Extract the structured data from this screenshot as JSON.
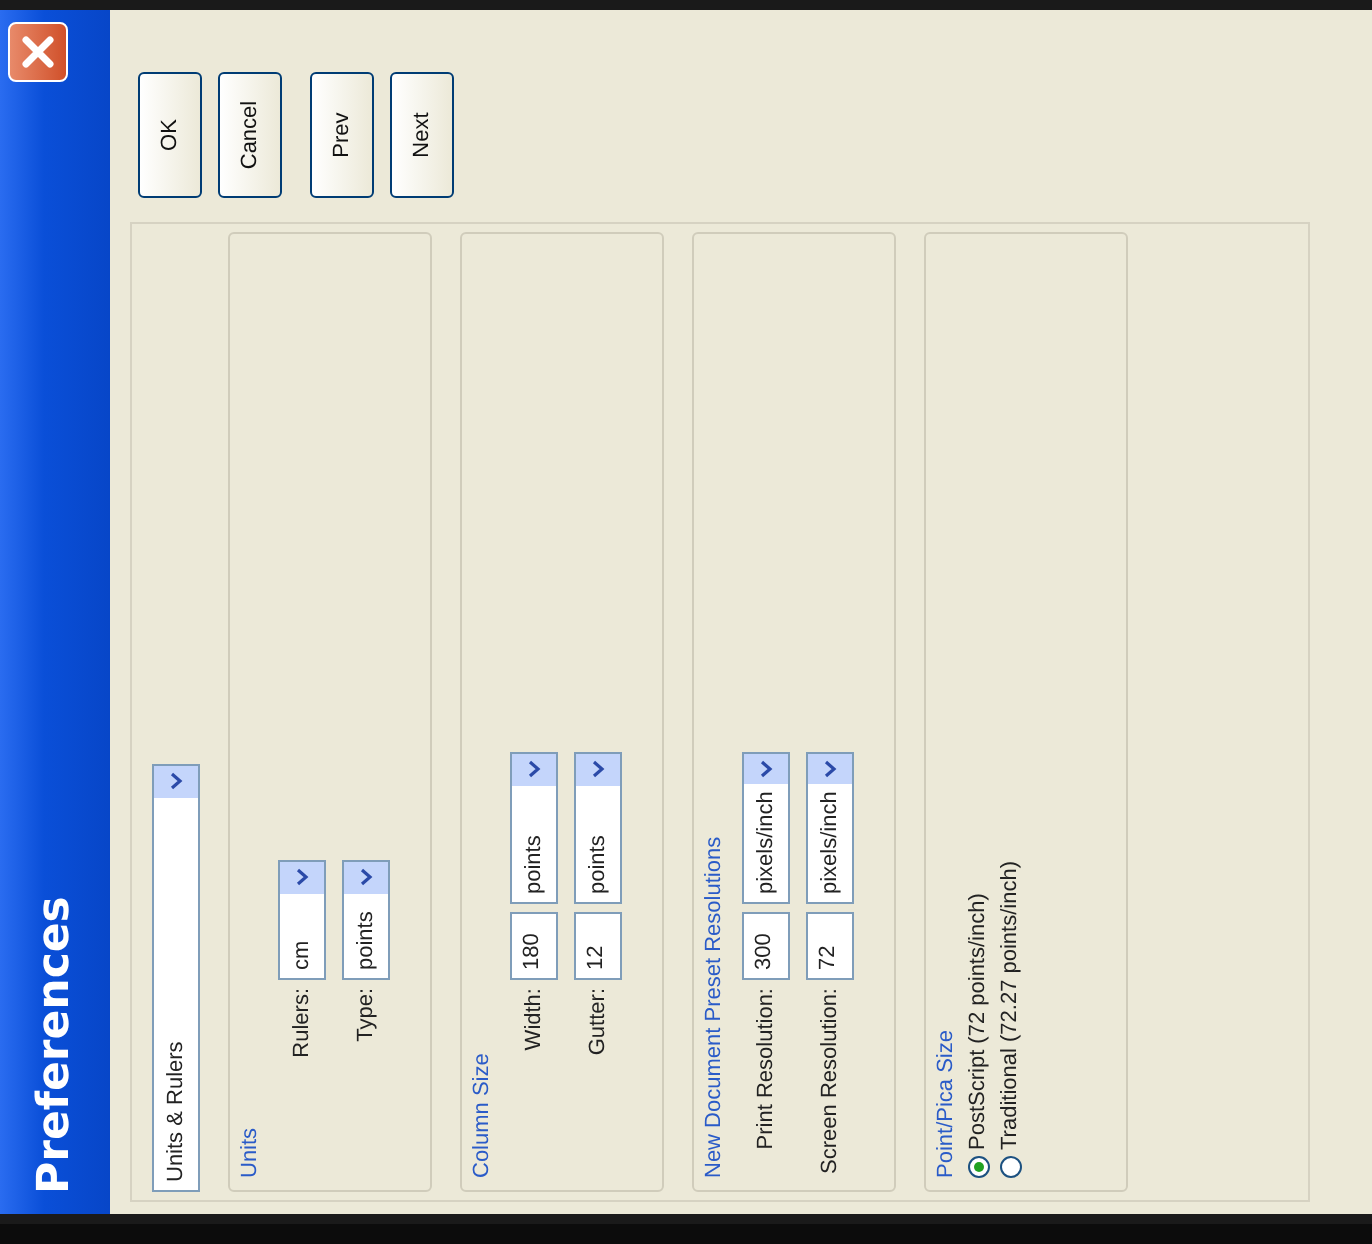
{
  "window": {
    "title": "Preferences"
  },
  "category": {
    "value": "Units & Rulers"
  },
  "groups": [
    {
      "title": "Units",
      "rows": [
        {
          "kind": "select",
          "label": "Rulers:",
          "value": "cm"
        },
        {
          "kind": "select",
          "label": "Type:",
          "value": "points"
        }
      ]
    },
    {
      "title": "Column Size",
      "rows": [
        {
          "kind": "number_unit",
          "label": "Width:",
          "value": "180",
          "unit": "points"
        },
        {
          "kind": "number_unit",
          "label": "Gutter:",
          "value": "12",
          "unit": "points"
        }
      ]
    },
    {
      "title": "New Document Preset Resolutions",
      "rows": [
        {
          "kind": "number_unit",
          "label": "Print Resolution:",
          "value": "300",
          "unit": "pixels/inch"
        },
        {
          "kind": "number_unit",
          "label": "Screen Resolution:",
          "value": "72",
          "unit": "pixels/inch"
        }
      ]
    },
    {
      "title": "Point/Pica Size",
      "rows": [
        {
          "kind": "radio",
          "label": "PostScript (72 points/inch)",
          "selected": true
        },
        {
          "kind": "radio",
          "label": "Traditional (72.27 points/inch)",
          "selected": false
        }
      ]
    }
  ],
  "actions": [
    "OK",
    "Cancel"
  ],
  "navigation": [
    "Prev",
    "Next"
  ]
}
